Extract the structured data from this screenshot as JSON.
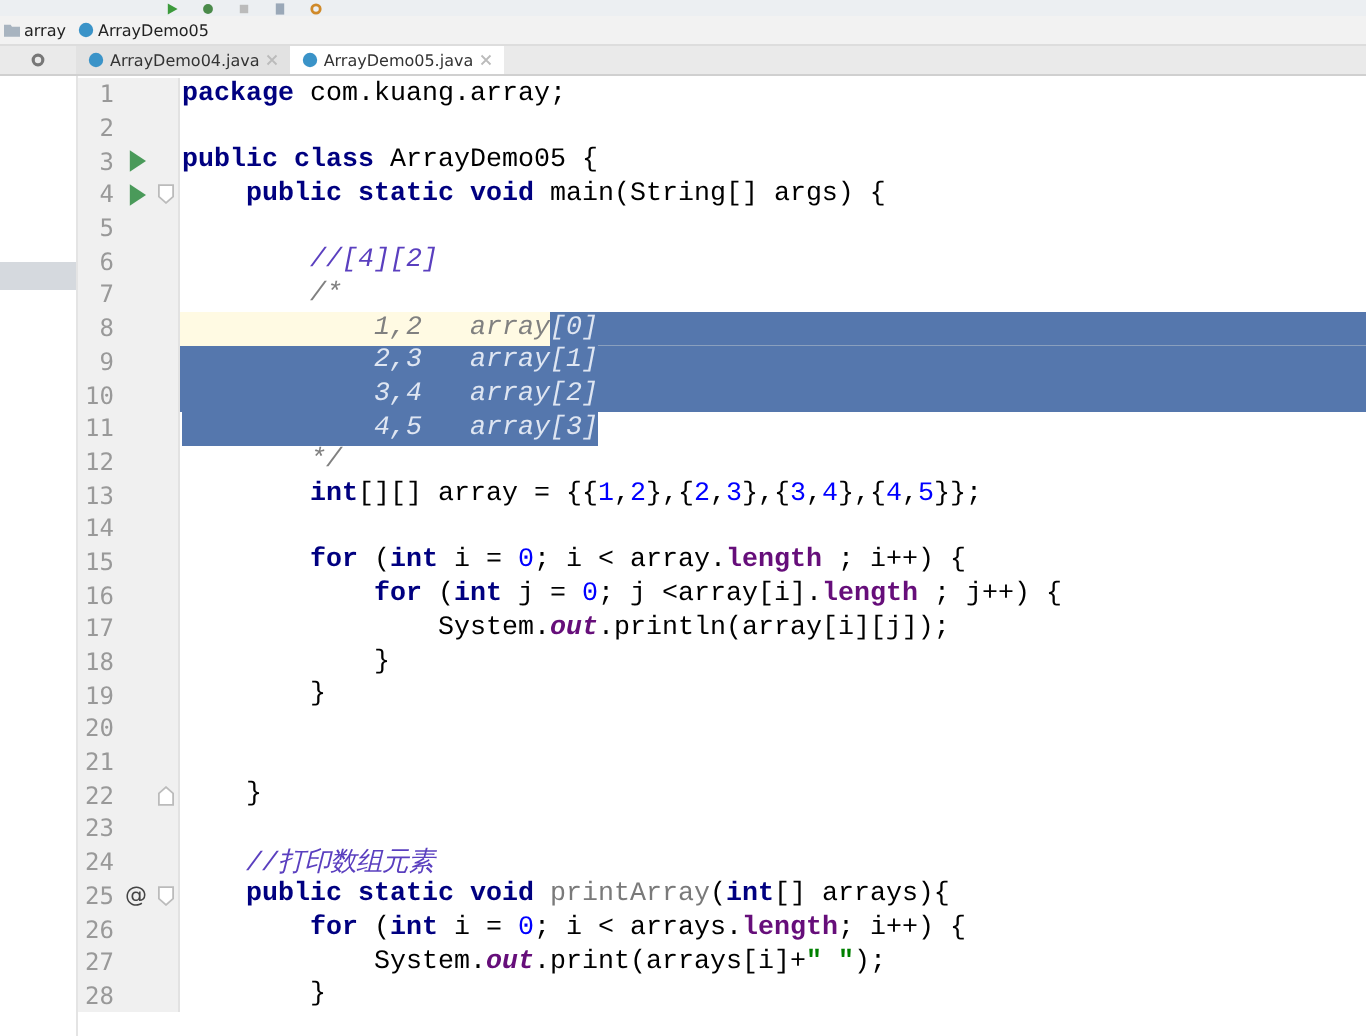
{
  "breadcrumb": [
    {
      "label": "array",
      "kind": "folder"
    },
    {
      "label": "ArrayDemo05",
      "kind": "class"
    }
  ],
  "tabs": [
    {
      "label": "ArrayDemo04.java",
      "selected": false
    },
    {
      "label": "ArrayDemo05.java",
      "selected": true
    }
  ],
  "editor": {
    "lines": [
      {
        "number": "1",
        "run": false,
        "fold_open": false,
        "fold_close": false,
        "current": false,
        "selected_to_end": false,
        "tokens": [
          {
            "kind": "kw",
            "text": "package"
          },
          {
            "kind": "plain",
            "text": " com.kuang.array;"
          }
        ]
      },
      {
        "number": "2",
        "run": false,
        "fold_open": false,
        "fold_close": false,
        "current": false,
        "selected_to_end": false
      },
      {
        "number": "3",
        "run": true,
        "fold_open": false,
        "fold_close": false,
        "current": false,
        "selected_to_end": false,
        "tokens": [
          {
            "kind": "kw",
            "text": "public class"
          },
          {
            "kind": "plain",
            "text": " ArrayDemo05 {"
          }
        ]
      },
      {
        "number": "4",
        "run": true,
        "fold_open": true,
        "fold_close": false,
        "current": false,
        "selected_to_end": false,
        "tokens": [
          {
            "kind": "kw",
            "text": "    public static void"
          },
          {
            "kind": "plain",
            "text": " main(String[] args) {"
          }
        ]
      },
      {
        "number": "5",
        "run": false,
        "fold_open": false,
        "fold_close": false,
        "current": false,
        "selected_to_end": false
      },
      {
        "number": "6",
        "run": false,
        "fold_open": false,
        "fold_close": false,
        "current": false,
        "selected_to_end": false,
        "tokens": [
          {
            "kind": "comment",
            "text": "        //[4][2]"
          }
        ]
      },
      {
        "number": "7",
        "run": false,
        "fold_open": false,
        "fold_close": false,
        "current": false,
        "selected_to_end": false,
        "tokens": [
          {
            "kind": "block",
            "text": "        /*"
          }
        ]
      },
      {
        "number": "8",
        "run": false,
        "fold_open": false,
        "fold_close": false,
        "current": true,
        "selected_to_end": true,
        "tokens": [
          {
            "kind": "block",
            "text": "            1,2   array",
            "selected": false
          },
          {
            "kind": "block",
            "text": "[0]",
            "selected": true
          }
        ]
      },
      {
        "number": "9",
        "run": false,
        "fold_open": false,
        "fold_close": false,
        "current": false,
        "selected_to_end": true,
        "tokens": [
          {
            "kind": "block",
            "text": "            2,3   array[1]",
            "selected": true
          }
        ]
      },
      {
        "number": "10",
        "run": false,
        "fold_open": false,
        "fold_close": false,
        "current": false,
        "selected_to_end": true,
        "tokens": [
          {
            "kind": "block",
            "text": "            3,4   array[2]",
            "selected": true
          }
        ]
      },
      {
        "number": "11",
        "run": false,
        "fold_open": false,
        "fold_close": false,
        "current": false,
        "selected_to_end": false,
        "tokens": [
          {
            "kind": "block",
            "text": "            4,5   array[3]",
            "selected": true
          }
        ]
      },
      {
        "number": "12",
        "run": false,
        "fold_open": false,
        "fold_close": false,
        "current": false,
        "selected_to_end": false,
        "tokens": [
          {
            "kind": "block",
            "text": "        */"
          }
        ]
      },
      {
        "number": "13",
        "run": false,
        "fold_open": false,
        "fold_close": false,
        "current": false,
        "selected_to_end": false,
        "tokens": [
          {
            "kind": "kw",
            "text": "        int"
          },
          {
            "kind": "plain",
            "text": "[][] array = {{"
          },
          {
            "kind": "num",
            "text": "1"
          },
          {
            "kind": "plain",
            "text": ","
          },
          {
            "kind": "num",
            "text": "2"
          },
          {
            "kind": "plain",
            "text": "},{"
          },
          {
            "kind": "num",
            "text": "2"
          },
          {
            "kind": "plain",
            "text": ","
          },
          {
            "kind": "num",
            "text": "3"
          },
          {
            "kind": "plain",
            "text": "},{"
          },
          {
            "kind": "num",
            "text": "3"
          },
          {
            "kind": "plain",
            "text": ","
          },
          {
            "kind": "num",
            "text": "4"
          },
          {
            "kind": "plain",
            "text": "},{"
          },
          {
            "kind": "num",
            "text": "4"
          },
          {
            "kind": "plain",
            "text": ","
          },
          {
            "kind": "num",
            "text": "5"
          },
          {
            "kind": "plain",
            "text": "}};"
          }
        ]
      },
      {
        "number": "14",
        "run": false,
        "fold_open": false,
        "fold_close": false,
        "current": false,
        "selected_to_end": false
      },
      {
        "number": "15",
        "run": false,
        "fold_open": false,
        "fold_close": false,
        "current": false,
        "selected_to_end": false,
        "tokens": [
          {
            "kind": "kw",
            "text": "        for"
          },
          {
            "kind": "plain",
            "text": " ("
          },
          {
            "kind": "kw",
            "text": "int"
          },
          {
            "kind": "plain",
            "text": " i = "
          },
          {
            "kind": "num",
            "text": "0"
          },
          {
            "kind": "plain",
            "text": "; i < array."
          },
          {
            "kind": "field",
            "text": "length"
          },
          {
            "kind": "plain",
            "text": " ; i++) {"
          }
        ]
      },
      {
        "number": "16",
        "run": false,
        "fold_open": false,
        "fold_close": false,
        "current": false,
        "selected_to_end": false,
        "tokens": [
          {
            "kind": "kw",
            "text": "            for"
          },
          {
            "kind": "plain",
            "text": " ("
          },
          {
            "kind": "kw",
            "text": "int"
          },
          {
            "kind": "plain",
            "text": " j = "
          },
          {
            "kind": "num",
            "text": "0"
          },
          {
            "kind": "plain",
            "text": "; j <array[i]."
          },
          {
            "kind": "field",
            "text": "length"
          },
          {
            "kind": "plain",
            "text": " ; j++) {"
          }
        ]
      },
      {
        "number": "17",
        "run": false,
        "fold_open": false,
        "fold_close": false,
        "current": false,
        "selected_to_end": false,
        "tokens": [
          {
            "kind": "plain",
            "text": "                System."
          },
          {
            "kind": "static",
            "text": "out"
          },
          {
            "kind": "plain",
            "text": ".println(array[i][j]);"
          }
        ]
      },
      {
        "number": "18",
        "run": false,
        "fold_open": false,
        "fold_close": false,
        "current": false,
        "selected_to_end": false,
        "tokens": [
          {
            "kind": "plain",
            "text": "            }"
          }
        ]
      },
      {
        "number": "19",
        "run": false,
        "fold_open": false,
        "fold_close": false,
        "current": false,
        "selected_to_end": false,
        "tokens": [
          {
            "kind": "plain",
            "text": "        }"
          }
        ]
      },
      {
        "number": "20",
        "run": false,
        "fold_open": false,
        "fold_close": false,
        "current": false,
        "selected_to_end": false
      },
      {
        "number": "21",
        "run": false,
        "fold_open": false,
        "fold_close": false,
        "current": false,
        "selected_to_end": false
      },
      {
        "number": "22",
        "run": false,
        "fold_open": false,
        "fold_close": true,
        "current": false,
        "selected_to_end": false,
        "tokens": [
          {
            "kind": "plain",
            "text": "    }"
          }
        ]
      },
      {
        "number": "23",
        "run": false,
        "fold_open": false,
        "fold_close": false,
        "current": false,
        "selected_to_end": false
      },
      {
        "number": "24",
        "run": false,
        "fold_open": false,
        "fold_close": false,
        "current": false,
        "selected_to_end": false,
        "tokens": [
          {
            "kind": "comment",
            "text": "    //打印数组元素"
          }
        ]
      },
      {
        "number": "25",
        "gutter_text": "@",
        "run": false,
        "fold_open": true,
        "fold_close": false,
        "current": false,
        "selected_to_end": false,
        "tokens": [
          {
            "kind": "kw",
            "text": "    public static void"
          },
          {
            "kind": "unused",
            "text": " printArray"
          },
          {
            "kind": "plain",
            "text": "("
          },
          {
            "kind": "kw",
            "text": "int"
          },
          {
            "kind": "plain",
            "text": "[] arrays){"
          }
        ]
      },
      {
        "number": "26",
        "run": false,
        "fold_open": false,
        "fold_close": false,
        "current": false,
        "selected_to_end": false,
        "tokens": [
          {
            "kind": "kw",
            "text": "        for"
          },
          {
            "kind": "plain",
            "text": " ("
          },
          {
            "kind": "kw",
            "text": "int"
          },
          {
            "kind": "plain",
            "text": " i = "
          },
          {
            "kind": "num",
            "text": "0"
          },
          {
            "kind": "plain",
            "text": "; i < arrays."
          },
          {
            "kind": "field",
            "text": "length"
          },
          {
            "kind": "plain",
            "text": "; i++) {"
          }
        ]
      },
      {
        "number": "27",
        "run": false,
        "fold_open": false,
        "fold_close": false,
        "current": false,
        "selected_to_end": false,
        "tokens": [
          {
            "kind": "plain",
            "text": "            System."
          },
          {
            "kind": "static",
            "text": "out"
          },
          {
            "kind": "plain",
            "text": ".print(arrays[i]+"
          },
          {
            "kind": "string",
            "text": "\" \""
          },
          {
            "kind": "plain",
            "text": ");"
          }
        ]
      },
      {
        "number": "28",
        "run": false,
        "fold_open": false,
        "fold_close": false,
        "current": false,
        "selected_to_end": false,
        "tokens": [
          {
            "kind": "plain",
            "text": "        }"
          }
        ]
      }
    ]
  }
}
